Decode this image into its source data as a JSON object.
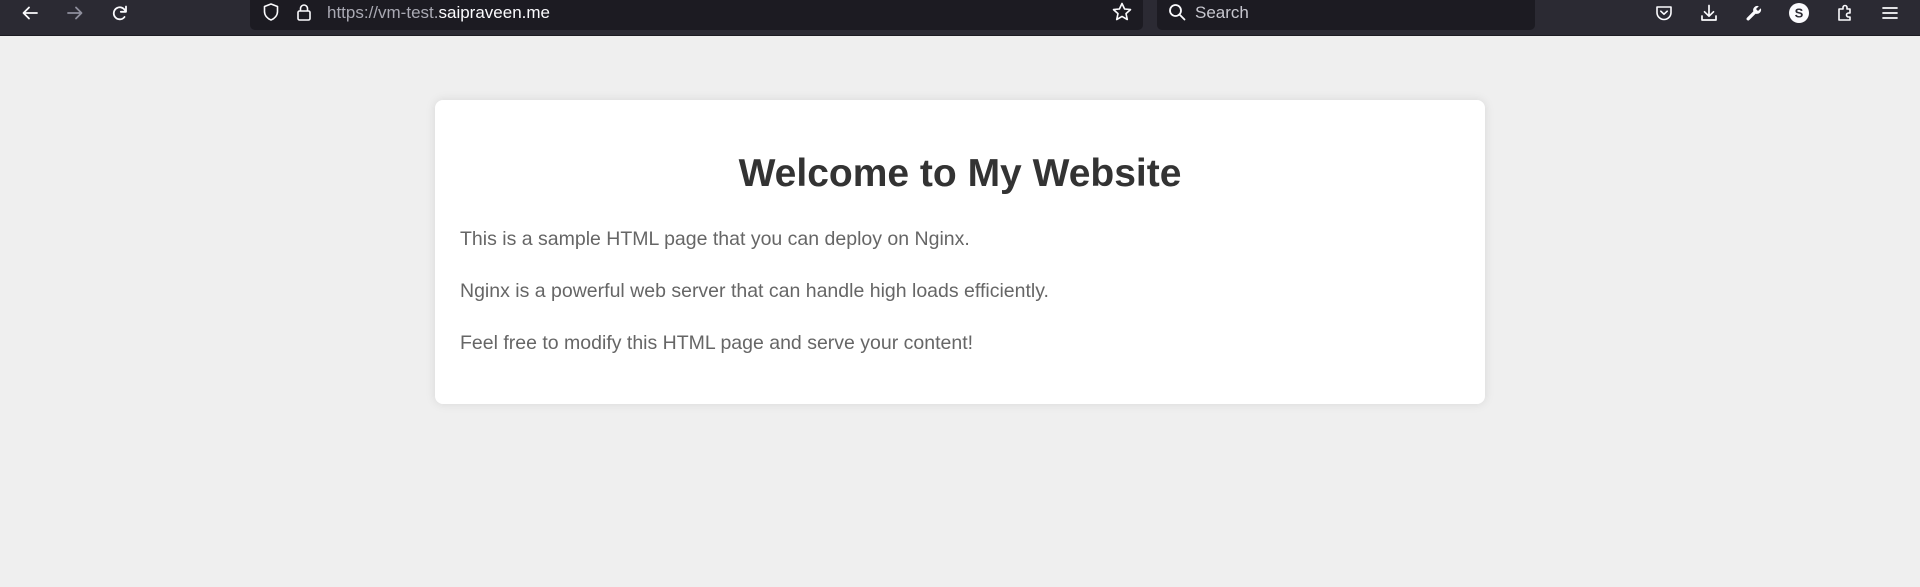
{
  "browser": {
    "url_prefix": "https://vm-test.",
    "url_domain": "saipraveen.me",
    "search_placeholder": "Search",
    "icons": [
      "back-icon",
      "forward-icon",
      "reload-icon",
      "shield-icon",
      "lock-icon",
      "star-icon",
      "search-icon",
      "pocket-icon",
      "download-icon",
      "wrench-icon",
      "account-icon",
      "extensions-icon",
      "menu-icon"
    ],
    "account_initial": "S"
  },
  "page": {
    "heading": "Welcome to My Website",
    "paragraphs": [
      "This is a sample HTML page that you can deploy on Nginx.",
      "Nginx is a powerful web server that can handle high loads efficiently.",
      "Feel free to modify this HTML page and serve your content!"
    ]
  },
  "colors": {
    "toolbar": "#2b2a33",
    "field": "#1c1b22",
    "page_background": "#efefef",
    "card": "#ffffff",
    "heading": "#333333",
    "body_text": "#666666"
  }
}
